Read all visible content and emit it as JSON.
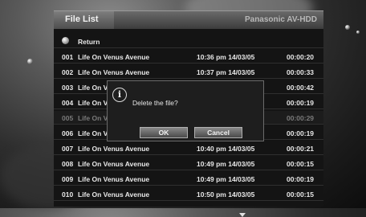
{
  "header": {
    "title": "File List",
    "brand": "Panasonic AV-HDD"
  },
  "return_label": "Return",
  "rows": [
    {
      "num": "001",
      "title": "Life On Venus Avenue",
      "date": "10:36 pm  14/03/05",
      "dur": "00:00:20"
    },
    {
      "num": "002",
      "title": "Life On Venus Avenue",
      "date": "10:37 pm  14/03/05",
      "dur": "00:00:33"
    },
    {
      "num": "003",
      "title": "Life On V",
      "date": "",
      "dur": "00:00:42"
    },
    {
      "num": "004",
      "title": "Life On V",
      "date": "",
      "dur": "00:00:19"
    },
    {
      "num": "005",
      "title": "Life On V",
      "date": "",
      "dur": "00:00:29"
    },
    {
      "num": "006",
      "title": "Life On V",
      "date": "",
      "dur": "00:00:19"
    },
    {
      "num": "007",
      "title": "Life On Venus Avenue",
      "date": "10:40 pm  14/03/05",
      "dur": "00:00:21"
    },
    {
      "num": "008",
      "title": "Life On Venus Avenue",
      "date": "10:49 pm  14/03/05",
      "dur": "00:00:15"
    },
    {
      "num": "009",
      "title": "Life On Venus Avenue",
      "date": "10:49 pm  14/03/05",
      "dur": "00:00:19"
    },
    {
      "num": "010",
      "title": "Life On Venus Avenue",
      "date": "10:50 pm  14/03/05",
      "dur": "00:00:15"
    }
  ],
  "dialog": {
    "icon": "info-icon",
    "icon_glyph": "i",
    "message": "Delete the file?",
    "ok_label": "OK",
    "cancel_label": "Cancel"
  },
  "scroll_icon": "down-arrow-icon"
}
